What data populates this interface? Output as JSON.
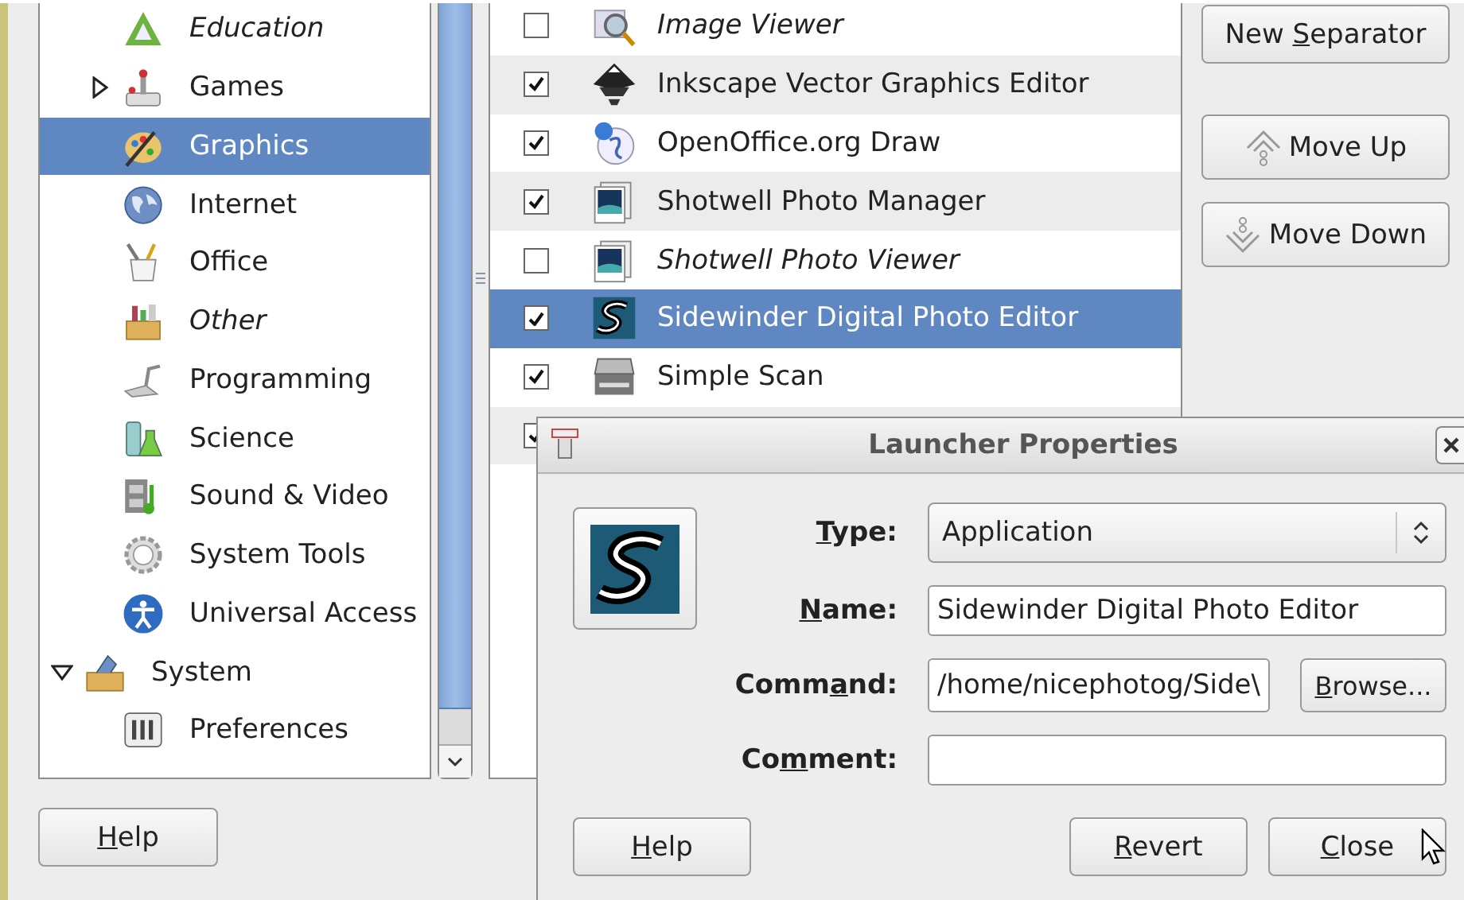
{
  "tree": {
    "items": [
      {
        "children": [
          {
            "label": "Education",
            "hidden": true,
            "selected": false
          },
          {
            "label": "Games",
            "hidden": false,
            "selected": false,
            "expanded": false
          },
          {
            "label": "Graphics",
            "hidden": false,
            "selected": true
          },
          {
            "label": "Internet",
            "hidden": false,
            "selected": false
          },
          {
            "label": "Office",
            "hidden": false,
            "selected": false
          },
          {
            "label": "Other",
            "hidden": true,
            "selected": false
          },
          {
            "label": "Programming",
            "hidden": false,
            "selected": false
          },
          {
            "label": "Science",
            "hidden": false,
            "selected": false
          },
          {
            "label": "Sound & Video",
            "hidden": false,
            "selected": false
          },
          {
            "label": "System Tools",
            "hidden": false,
            "selected": false
          },
          {
            "label": "Universal Access",
            "hidden": false,
            "selected": false
          }
        ]
      },
      {
        "label": "System",
        "hidden": false,
        "selected": false,
        "expanded": true,
        "children": [
          {
            "label": "Preferences",
            "hidden": false,
            "selected": false
          }
        ]
      }
    ]
  },
  "items": [
    {
      "label": "Image Viewer",
      "checked": false,
      "selected": false
    },
    {
      "label": "Inkscape Vector Graphics Editor",
      "checked": true,
      "selected": false
    },
    {
      "label": "OpenOffice.org Draw",
      "checked": true,
      "selected": false
    },
    {
      "label": "Shotwell Photo Manager",
      "checked": true,
      "selected": false
    },
    {
      "label": "Shotwell Photo Viewer",
      "checked": false,
      "selected": false
    },
    {
      "label": "Sidewinder Digital Photo Editor",
      "checked": true,
      "selected": true
    },
    {
      "label": "Simple Scan",
      "checked": true,
      "selected": false
    },
    {
      "checked": true,
      "selected": false
    }
  ],
  "actions": {
    "new_separator": {
      "pre": "New ",
      "key": "S",
      "post": "eparator"
    },
    "move_up": "Move Up",
    "move_down": "Move Down"
  },
  "help_button": {
    "key": "H",
    "post": "elp"
  },
  "dialog": {
    "title": "Launcher Properties",
    "fields": [
      {
        "kind": "combo",
        "label": {
          "key": "T",
          "post": "ype:"
        },
        "value": "Application"
      },
      {
        "kind": "text",
        "label": {
          "key": "N",
          "post": "ame:"
        },
        "value": "Sidewinder Digital Photo Editor"
      },
      {
        "kind": "browse",
        "label": {
          "pre": "Comm",
          "key": "a",
          "post": "nd:"
        },
        "value": "/home/nicephotog/Side\\",
        "button": {
          "key": "B",
          "post": "rowse..."
        }
      },
      {
        "kind": "text",
        "label": {
          "pre": "Co",
          "key": "m",
          "post": "ment:"
        }
      }
    ],
    "help": {
      "key": "H",
      "post": "elp"
    },
    "revert": {
      "key": "R",
      "post": "evert"
    },
    "close": {
      "key": "C",
      "post": "lose"
    }
  }
}
